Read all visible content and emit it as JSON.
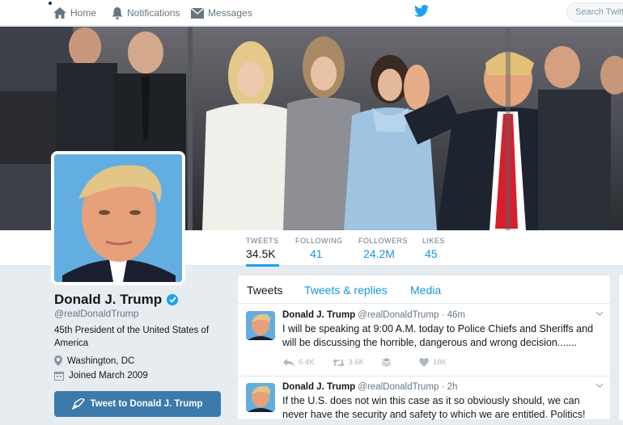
{
  "topbar": {
    "home_label": "Home",
    "notifications_label": "Notifications",
    "messages_label": "Messages",
    "search_placeholder": "Search Twitter"
  },
  "profile_nav": {
    "stats": [
      {
        "label": "TWEETS",
        "value": "34.5K"
      },
      {
        "label": "FOLLOWING",
        "value": "41"
      },
      {
        "label": "FOLLOWERS",
        "value": "24.2M"
      },
      {
        "label": "LIKES",
        "value": "45"
      }
    ]
  },
  "profile": {
    "name": "Donald J. Trump",
    "handle": "@realDonaldTrump",
    "bio": "45th President of the United States of America",
    "location": "Washington, DC",
    "joined": "Joined March 2009",
    "tweet_to_label": "Tweet to Donald J. Trump"
  },
  "timeline": {
    "tabs": [
      "Tweets",
      "Tweets & replies",
      "Media"
    ],
    "tweets": [
      {
        "name": "Donald J. Trump",
        "handle": "@realDonaldTrump",
        "time": "· 46m",
        "text": "I will be speaking at 9:00 A.M. today to Police Chiefs and Sheriffs and will be discussing the horrible, dangerous and wrong decision.......",
        "replies": "6.4K",
        "retweets": "3.6K",
        "likes": "18K"
      },
      {
        "name": "Donald J. Trump",
        "handle": "@realDonaldTrump",
        "time": "· 2h",
        "text": "If the U.S. does not win this case as it so obviously should, we can never have the security and safety to which we are entitled. Politics!"
      }
    ]
  },
  "colors": {
    "accent": "#1da1f2",
    "link": "#1b95e0",
    "button": "#3b7aab",
    "background": "#e6ecf0"
  }
}
